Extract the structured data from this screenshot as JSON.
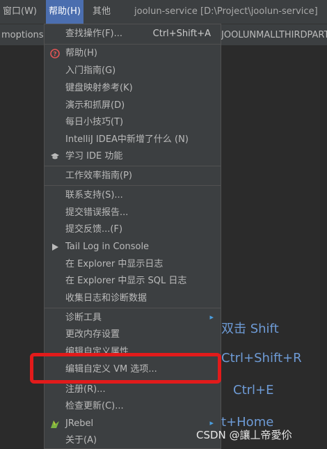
{
  "menubar": {
    "items": [
      "窗口(W)",
      "帮助(H)",
      "其他"
    ],
    "title": "joolun-service [D:\\Project\\joolun-service]"
  },
  "toolbar": {
    "left_tab": "moptions",
    "right_tab": "JOOLUNMALLTHIRDPART"
  },
  "menu": {
    "find_action": {
      "label": "查找操作(F)...",
      "shortcut": "Ctrl+Shift+A"
    },
    "help": "帮助(H)",
    "getting_started": "入门指南(G)",
    "keymap_ref": "键盘映射参考(K)",
    "demos": "演示和抓屏(D)",
    "tip_of_day": "每日小技巧(T)",
    "whats_new": "IntelliJ IDEA中新增了什么 (N)",
    "learn_ide": "学习 IDE 功能",
    "productivity": "工作效率指南(P)",
    "contact_support": "联系支持(S)...",
    "submit_bug": "提交错误报告...",
    "submit_feedback": "提交反馈...(F)",
    "tail_log": "Tail Log in Console",
    "show_log": "在 Explorer 中显示日志",
    "show_sql_log": "在 Explorer 中显示 SQL 日志",
    "collect_logs": "收集日志和诊断数据",
    "diagnostic_tools": "诊断工具",
    "change_memory": "更改内存设置",
    "edit_properties": "编辑自定义属性...",
    "edit_vm_options": "编辑自定义 VM 选项...",
    "register": "注册(R)...",
    "check_updates": "检查更新(C)...",
    "jrebel": "JRebel",
    "about": "关于(A)"
  },
  "hints": {
    "search_everywhere": "双击 Shift",
    "goto_file": "Ctrl+Shift+R",
    "recent_files": "Ctrl+E",
    "nav_bar": "t+Home"
  },
  "watermark": "CSDN @讓丄帝愛伱",
  "colors": {
    "highlight": "#4b6eaf",
    "annotation": "#e21b1b"
  }
}
